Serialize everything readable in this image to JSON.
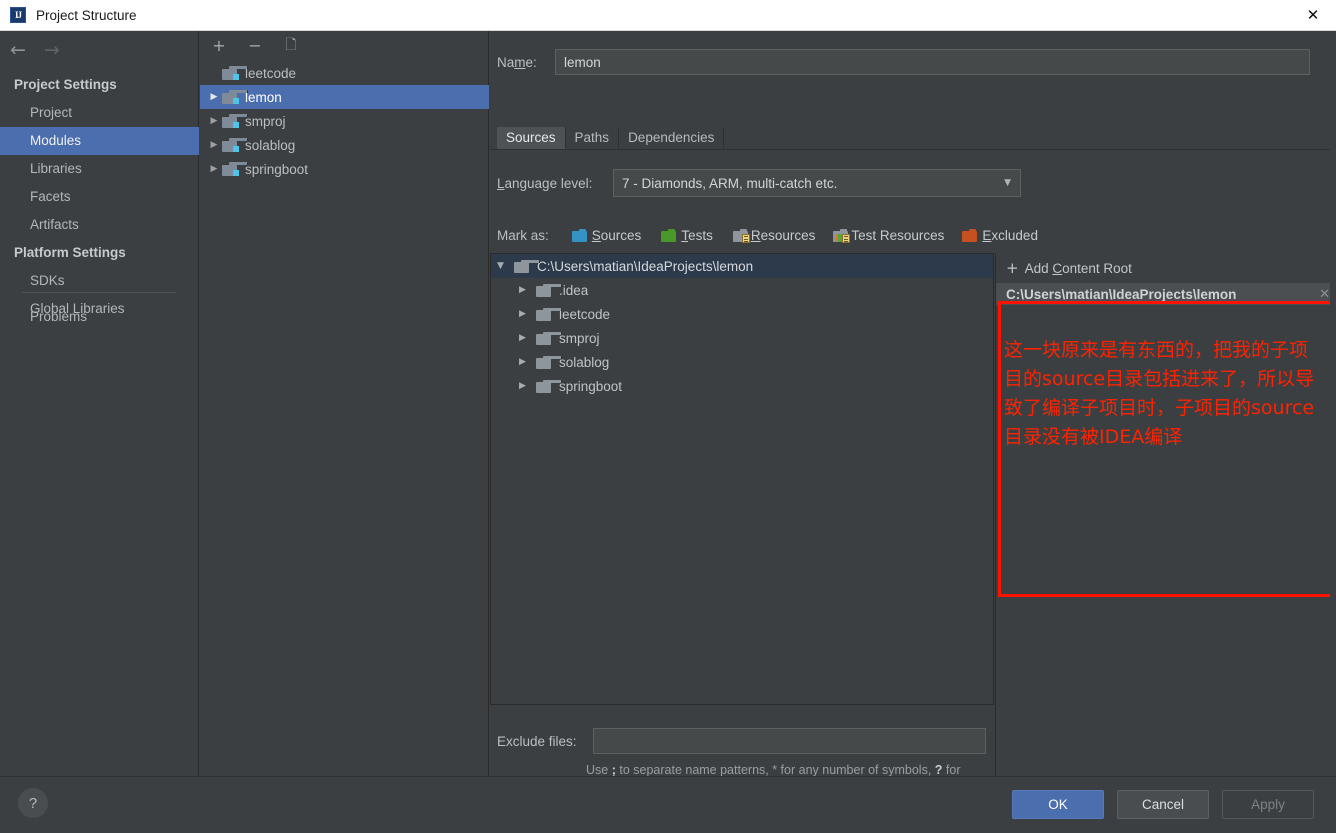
{
  "window": {
    "title": "Project Structure",
    "app_icon": "intellij-idea-icon",
    "close_icon": "close-icon"
  },
  "sidebar": {
    "back_icon": "back-arrow-icon",
    "forward_icon": "forward-arrow-icon",
    "groups": [
      {
        "title": "Project Settings",
        "items": [
          {
            "label": "Project",
            "selected": false
          },
          {
            "label": "Modules",
            "selected": true
          },
          {
            "label": "Libraries",
            "selected": false
          },
          {
            "label": "Facets",
            "selected": false
          },
          {
            "label": "Artifacts",
            "selected": false
          }
        ]
      },
      {
        "title": "Platform Settings",
        "items": [
          {
            "label": "SDKs",
            "selected": false
          },
          {
            "label": "Global Libraries",
            "selected": false
          }
        ]
      }
    ],
    "problems": {
      "label": "Problems"
    }
  },
  "module_panel": {
    "toolbar": [
      {
        "name": "add-module-button",
        "glyph": "+"
      },
      {
        "name": "remove-module-button",
        "glyph": "−"
      },
      {
        "name": "copy-module-button",
        "glyph": "❐"
      }
    ],
    "modules": [
      {
        "label": "leetcode",
        "expandable": false,
        "selected": false
      },
      {
        "label": "lemon",
        "expandable": true,
        "selected": true
      },
      {
        "label": "smproj",
        "expandable": true,
        "selected": false
      },
      {
        "label": "solablog",
        "expandable": true,
        "selected": false
      },
      {
        "label": "springboot",
        "expandable": true,
        "selected": false
      }
    ]
  },
  "main": {
    "name_label": "Name:",
    "name_label_pre": "Na",
    "name_label_accel": "m",
    "name_label_post": "e:",
    "name_value": "lemon",
    "name_placeholder": "",
    "tabs": [
      {
        "label": "Sources",
        "active": true
      },
      {
        "label": "Paths",
        "active": false
      },
      {
        "label": "Dependencies",
        "active": false
      }
    ],
    "language_level": {
      "label_accel": "L",
      "label_post": "anguage level:",
      "value": "7 - Diamonds, ARM, multi-catch etc.",
      "arrow_icon": "chevron-down-icon"
    },
    "mark_as": {
      "label": "Mark as:",
      "options": [
        {
          "label": "Sources",
          "accel": "S",
          "rest": "ources",
          "color": "#3592c4",
          "kind": "plain"
        },
        {
          "label": "Tests",
          "accel": "T",
          "rest": "ests",
          "color": "#49992a",
          "kind": "plain"
        },
        {
          "label": "Resources",
          "accel": "R",
          "rest": "esources",
          "color": "#8e959c",
          "kind": "lines"
        },
        {
          "label": "Test Resources",
          "accel": "",
          "rest": "Test Resources",
          "color": "#8e959c",
          "kind": "testres"
        },
        {
          "label": "Excluded",
          "accel": "E",
          "rest": "xcluded",
          "color": "#c4511f",
          "kind": "plain"
        }
      ]
    },
    "tree": {
      "root": {
        "label": "C:\\Users\\matian\\IdeaProjects\\lemon",
        "expanded": true
      },
      "children": [
        {
          "label": ".idea",
          "expanded": false
        },
        {
          "label": "leetcode",
          "expanded": false
        },
        {
          "label": "smproj",
          "expanded": false
        },
        {
          "label": "solablog",
          "expanded": false
        },
        {
          "label": "springboot",
          "expanded": false
        }
      ]
    },
    "exclude": {
      "label": "Exclude files:",
      "value": "",
      "placeholder": "",
      "hint_1": "Use ",
      "hint_sep": ";",
      "hint_2": " to separate name patterns, * for any number of symbols, ",
      "hint_q": "?",
      "hint_3": " for one."
    }
  },
  "content_root_panel": {
    "add_button": {
      "plus": "+",
      "pre": "Add ",
      "accel": "C",
      "post": "ontent Root"
    },
    "header_path": "C:\\Users\\matian\\IdeaProjects\\lemon",
    "close_icon": "close-icon"
  },
  "annotation": {
    "text": "这一块原来是有东西的，把我的子项目的source目录包括进来了，所以导致了编译子项目时，子项目的source目录没有被IDEA编译",
    "color": "#ff2200",
    "border_color": "#ff1200"
  },
  "footer": {
    "help_icon": "question-mark-icon",
    "help_label": "?",
    "ok_label": "OK",
    "cancel_label": "Cancel",
    "apply_label": "Apply"
  },
  "colors": {
    "background": "#3c3f41",
    "accent_selection": "#4b6eaf",
    "tree_root_selection": "#2d3a4c",
    "field_background": "#45494a",
    "text_primary": "#bbbfc2",
    "annotation_red": "#ff2200"
  }
}
